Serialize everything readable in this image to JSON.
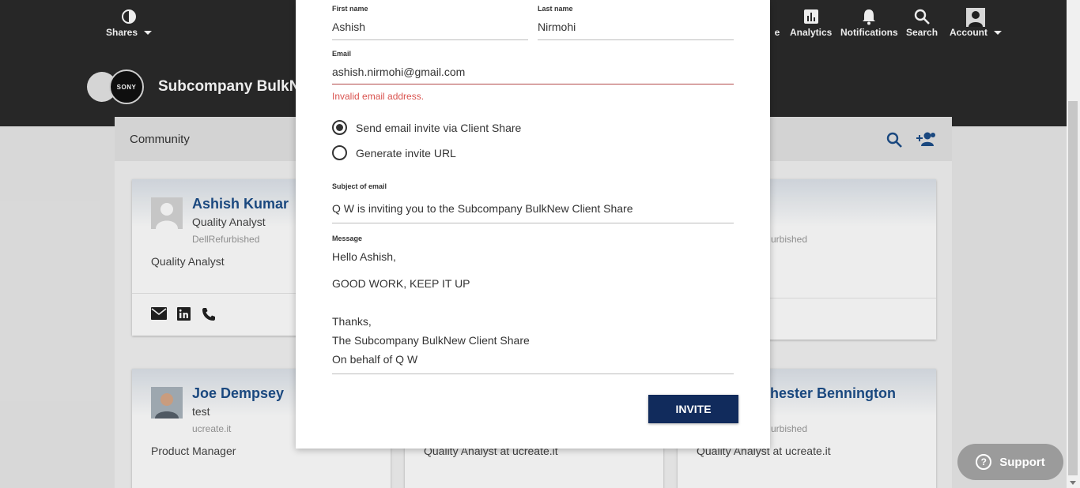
{
  "header": {
    "shares_label": "Shares",
    "nav": [
      {
        "label": "e",
        "icon": "partial-icon"
      },
      {
        "label": "Analytics",
        "icon": "analytics-icon"
      },
      {
        "label": "Notifications",
        "icon": "bell-icon"
      },
      {
        "label": "Search",
        "icon": "search-icon"
      },
      {
        "label": "Account",
        "icon": "avatar"
      }
    ],
    "logo_text": "SONY",
    "company_name": "Subcompany BulkNew Client Share"
  },
  "community": {
    "title": "Community",
    "cards": [
      {
        "name": "Ashish Kumar",
        "title": "Quality Analyst",
        "company": "DellRefurbished",
        "bio": "Quality Analyst"
      },
      {
        "name": "",
        "title": "",
        "company": "urbished",
        "bio": ""
      },
      {
        "name": "Joe Dempsey",
        "title": "test",
        "company": "ucreate.it",
        "bio": "Product Manager"
      },
      {
        "name": "",
        "title": "",
        "company": "",
        "bio": "Quality Analyst at ucreate.it"
      },
      {
        "name": "hester Bennington",
        "title": "",
        "company": "urbished",
        "bio": "Quality Analyst at ucreate.it"
      }
    ]
  },
  "modal": {
    "first_name_label": "First name",
    "first_name_value": "Ashish",
    "last_name_label": "Last name",
    "last_name_value": "Nirmohi",
    "email_label": "Email",
    "email_value": "ashish.nirmohi@gmail.com",
    "email_error": "Invalid email address.",
    "radio_send": "Send email invite via Client Share",
    "radio_generate": "Generate invite URL",
    "radio_selected": "send",
    "subject_label": "Subject of email",
    "subject_value": "Q W is inviting you to the Subcompany BulkNew Client Share",
    "message_label": "Message",
    "message_lines": [
      "Hello Ashish,",
      "GOOD WORK, KEEP IT UP",
      "Thanks,",
      "The Subcompany BulkNew Client Share",
      "On behalf of Q W"
    ],
    "invite_label": "INVITE"
  },
  "support": {
    "label": "Support"
  },
  "colors": {
    "accent": "#112b5c",
    "error": "#d9534f",
    "link": "#1d4e89",
    "header_bg": "#2a2a2a"
  }
}
